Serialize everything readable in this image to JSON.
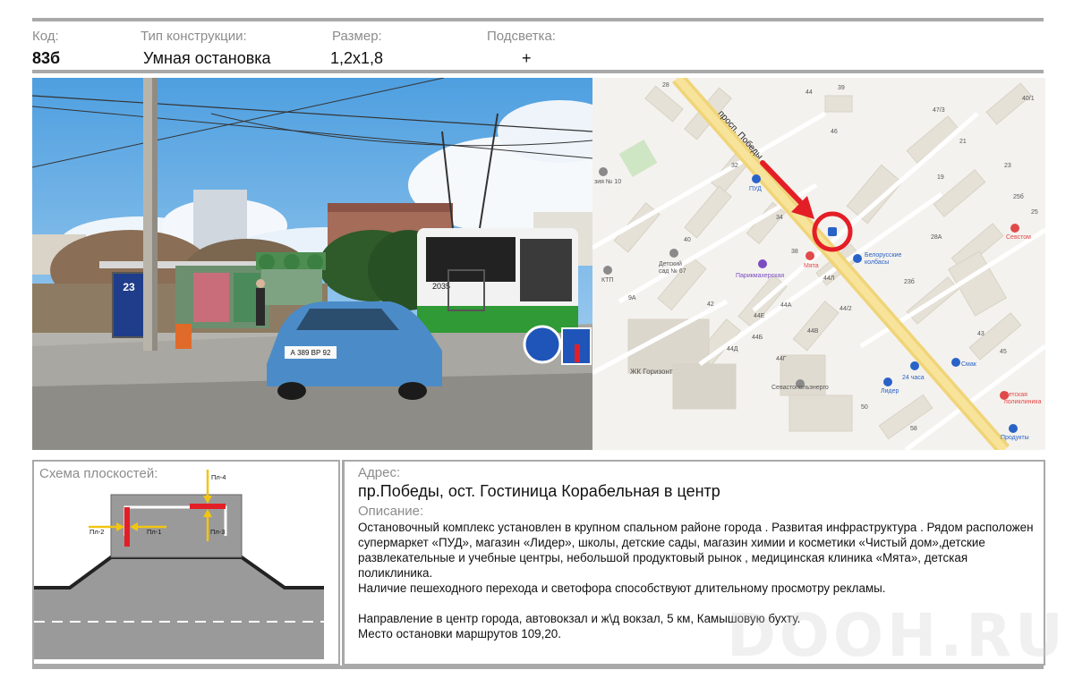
{
  "header": {
    "code_label": "Код:",
    "code_value": "83б",
    "type_label": "Тип конструкции:",
    "type_value": "Умная остановка",
    "size_label": "Размер:",
    "size_value": "1,2х1,8",
    "light_label": "Подсветка:",
    "light_value": "+"
  },
  "photo": {
    "plate": "А 389 ВР 92",
    "bus_number": "2035",
    "billboard_number": "23"
  },
  "map": {
    "street": "просп. Победы",
    "labels": [
      {
        "text": "28"
      },
      {
        "text": "39"
      },
      {
        "text": "44"
      },
      {
        "text": "47/3"
      },
      {
        "text": "40/1"
      },
      {
        "text": "46"
      },
      {
        "text": "21"
      },
      {
        "text": "32"
      },
      {
        "text": "ПУД"
      },
      {
        "text": "зия № 10"
      },
      {
        "text": "19"
      },
      {
        "text": "23"
      },
      {
        "text": "34"
      },
      {
        "text": "25б"
      },
      {
        "text": "25"
      },
      {
        "text": "Севстом"
      },
      {
        "text": "40"
      },
      {
        "text": "Детский"
      },
      {
        "text": "сад № 67"
      },
      {
        "text": "38"
      },
      {
        "text": "Мята"
      },
      {
        "text": "Белорусские"
      },
      {
        "text": "колбасы"
      },
      {
        "text": "28А"
      },
      {
        "text": "Парикмахерская"
      },
      {
        "text": "КТП"
      },
      {
        "text": "44Л"
      },
      {
        "text": "23б"
      },
      {
        "text": "9А"
      },
      {
        "text": "42"
      },
      {
        "text": "44А"
      },
      {
        "text": "44/2"
      },
      {
        "text": "44Е"
      },
      {
        "text": "44Б"
      },
      {
        "text": "44В"
      },
      {
        "text": "43"
      },
      {
        "text": "44Д"
      },
      {
        "text": "44Г"
      },
      {
        "text": "ЖК Горизонт"
      },
      {
        "text": "Смак"
      },
      {
        "text": "45"
      },
      {
        "text": "24 часа"
      },
      {
        "text": "Севастопольэнерго"
      },
      {
        "text": "Лидер"
      },
      {
        "text": "Детская"
      },
      {
        "text": "поликлиника"
      },
      {
        "text": "50"
      },
      {
        "text": "58"
      },
      {
        "text": "Продукты"
      }
    ]
  },
  "scheme": {
    "title": "Схема плоскостей:",
    "planes": [
      "Пл-1",
      "Пл-2",
      "Пл-3",
      "Пл-4"
    ]
  },
  "address": {
    "label": "Адрес:",
    "value": "пр.Победы, ост. Гостиница Корабельная в центр"
  },
  "description": {
    "label": "Описание:",
    "p1": "Остановочный комплекс установлен в крупном спальном районе города . Развитая инфраструктура . Рядом расположен супермаркет «ПУД», магазин «Лидер», школы, детские сады, магазин химии и косметики «Чистый дом»,детские развлекательные и учебные центры, небольшой продуктовый рынок , медицинская клиника «Мята», детская поликлиника.",
    "p2": "Наличие пешеходного перехода и светофора способствуют длительному просмотру рекламы.",
    "p3": "Направление в центр города, автовокзал и ж\\д вокзал, 5 км, Камышовую бухту.",
    "p4": "Место остановки маршрутов 109,20."
  },
  "watermark": "DOOH.RU",
  "colors": {
    "rule": "#a9a9a9",
    "label_gray": "#8c8c8c",
    "marker_red": "#e41e26",
    "plane_yellow": "#f2c511",
    "bus_green": "#2f9a36",
    "car_blue": "#4b8cc8"
  }
}
